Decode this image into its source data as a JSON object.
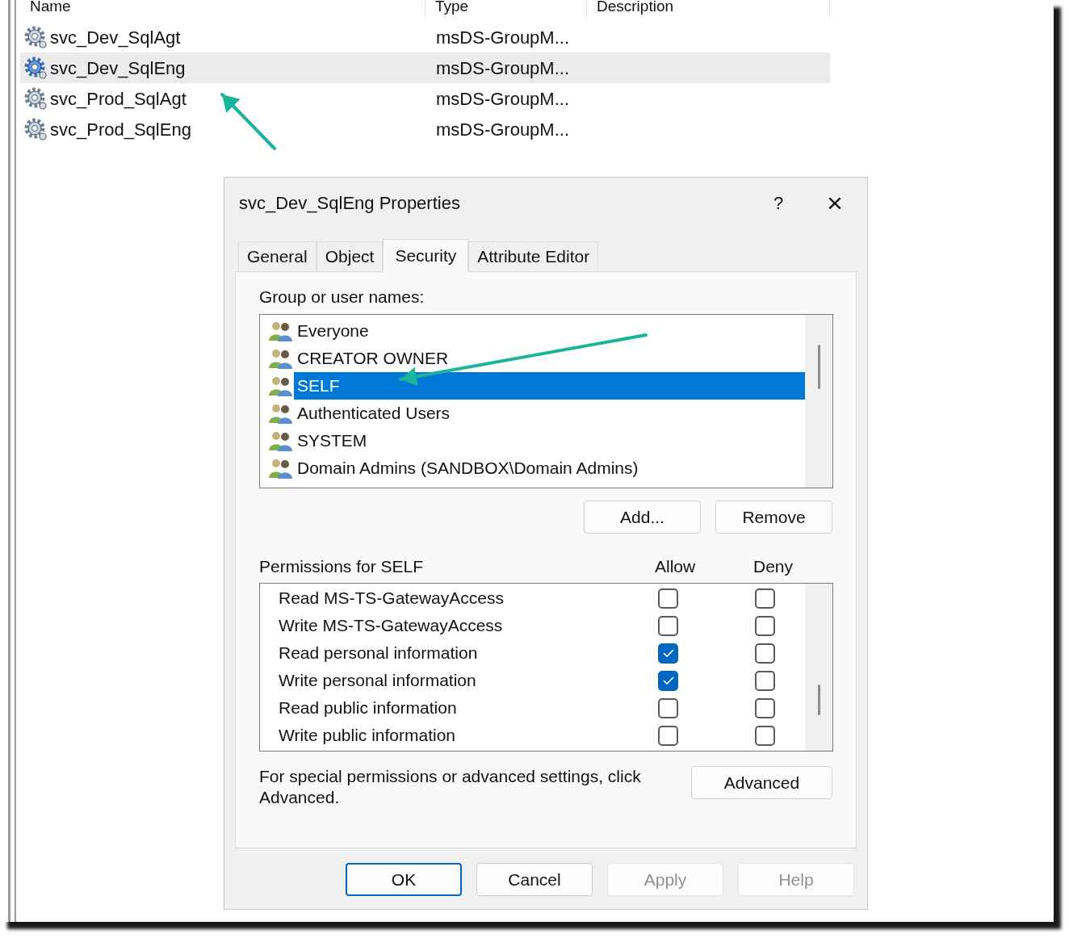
{
  "columns": [
    {
      "label": "Name"
    },
    {
      "label": "Type"
    },
    {
      "label": "Description"
    }
  ],
  "objects": [
    {
      "name": "svc_Dev_SqlAgt",
      "type": "msDS-GroupM...",
      "selected": false
    },
    {
      "name": "svc_Dev_SqlEng",
      "type": "msDS-GroupM...",
      "selected": true
    },
    {
      "name": "svc_Prod_SqlAgt",
      "type": "msDS-GroupM...",
      "selected": false
    },
    {
      "name": "svc_Prod_SqlEng",
      "type": "msDS-GroupM...",
      "selected": false
    }
  ],
  "dialog": {
    "title": "svc_Dev_SqlEng Properties",
    "help": "?",
    "close": "×",
    "tabs": [
      {
        "label": "General",
        "selected": false
      },
      {
        "label": "Object",
        "selected": false
      },
      {
        "label": "Security",
        "selected": true
      },
      {
        "label": "Attribute Editor",
        "selected": false
      }
    ],
    "group_label": "Group or user names:",
    "principals": [
      {
        "name": "Everyone",
        "selected": false
      },
      {
        "name": "CREATOR OWNER",
        "selected": false
      },
      {
        "name": "SELF",
        "selected": true
      },
      {
        "name": "Authenticated Users",
        "selected": false
      },
      {
        "name": "SYSTEM",
        "selected": false
      },
      {
        "name": "Domain Admins (SANDBOX\\Domain Admins)",
        "selected": false
      }
    ],
    "principal_buttons": [
      "Add...",
      "Remove"
    ],
    "permissions_label": "Permissions for SELF",
    "allow_label": "Allow",
    "deny_label": "Deny",
    "permissions": [
      {
        "name": "Read MS-TS-GatewayAccess",
        "allow": false,
        "deny": false
      },
      {
        "name": "Write MS-TS-GatewayAccess",
        "allow": false,
        "deny": false
      },
      {
        "name": "Read personal information",
        "allow": true,
        "deny": false
      },
      {
        "name": "Write personal information",
        "allow": true,
        "deny": false
      },
      {
        "name": "Read public information",
        "allow": false,
        "deny": false
      },
      {
        "name": "Write public information",
        "allow": false,
        "deny": false
      }
    ],
    "advanced_text": "For special permissions or advanced settings, click Advanced.",
    "advanced_button": "Advanced",
    "buttons": [
      {
        "label": "OK",
        "kind": "default",
        "disabled": false
      },
      {
        "label": "Cancel",
        "kind": "normal",
        "disabled": false
      },
      {
        "label": "Apply",
        "kind": "normal",
        "disabled": true
      },
      {
        "label": "Help",
        "kind": "normal",
        "disabled": true
      }
    ]
  }
}
